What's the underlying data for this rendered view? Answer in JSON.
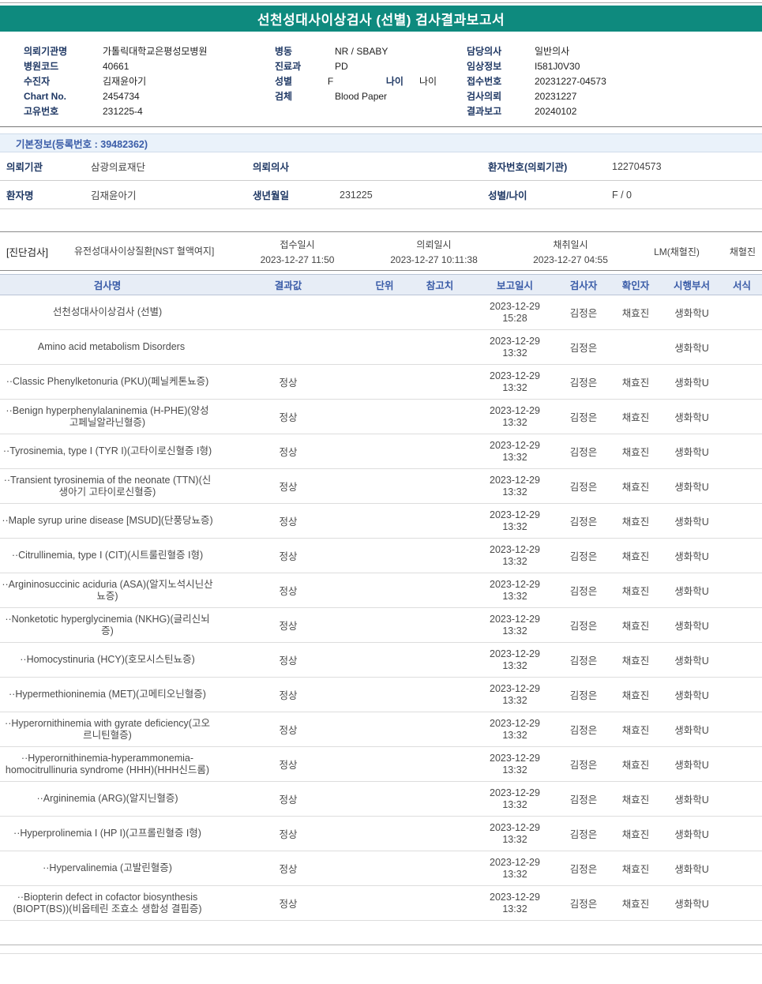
{
  "colors": {
    "accent": "#0E8A7E",
    "label": "#1F3864",
    "blue": "#3A5CA8",
    "theadbg": "#E7EDF6",
    "sectionbg": "#EAF2FA"
  },
  "report": {
    "title": "선천성대사이상검사 (선별) 검사결과보고서"
  },
  "header_info": {
    "left": [
      {
        "label": "의뢰기관명",
        "value": "가톨릭대학교은평성모병원"
      },
      {
        "label": "병원코드",
        "value": "40661"
      },
      {
        "label": "수진자",
        "value": "김재윤아기"
      },
      {
        "label": "Chart No.",
        "value": "2454734"
      },
      {
        "label": "고유번호",
        "value": "231225-4"
      }
    ],
    "middle": [
      {
        "label": "병동",
        "value": "NR / SBABY"
      },
      {
        "label": "진료과",
        "value": "PD"
      },
      {
        "label": "성별",
        "value": "F",
        "label2": "나이",
        "value2": "나이"
      },
      {
        "label": "검체",
        "value": "Blood Paper"
      }
    ],
    "right": [
      {
        "label": "담당의사",
        "value": "일반의사"
      },
      {
        "label": "임상정보",
        "value": "I581J0V30"
      },
      {
        "label": "접수번호",
        "value": "20231227-04573"
      },
      {
        "label": "검사의뢰",
        "value": "20231227"
      },
      {
        "label": "결과보고",
        "value": "20240102"
      }
    ]
  },
  "basic_info": {
    "title": "기본정보(등록번호 : 39482362)",
    "rows": [
      [
        {
          "label": "의뢰기관",
          "value": "삼광의료재단"
        },
        {
          "label": "의뢰의사",
          "value": ""
        },
        {
          "label": "환자번호(의뢰기관)",
          "value": "122704573"
        }
      ],
      [
        {
          "label": "환자명",
          "value": "김재윤아기"
        },
        {
          "label": "생년월일",
          "value": "231225"
        },
        {
          "label": "성별/나이",
          "value": "F / 0"
        }
      ]
    ]
  },
  "diagnosis": {
    "tag": "[진단검사]",
    "test_name": "유전성대사이상질환[NST 혈액여지]",
    "times": [
      {
        "label": "접수일시",
        "value": "2023-12-27 11:50"
      },
      {
        "label": "의뢰일시",
        "value": "2023-12-27 10:11:38"
      },
      {
        "label": "채취일시",
        "value": "2023-12-27 04:55"
      }
    ],
    "collector": "LM(채혈진)",
    "collector2": "채혈진"
  },
  "results": {
    "headers": [
      "검사명",
      "결과값",
      "단위",
      "참고치",
      "보고일시",
      "검사자",
      "확인자",
      "시행부서",
      "서식"
    ],
    "rows": [
      {
        "name": "선천성대사이상검사 (선별)",
        "result": "",
        "unit": "",
        "ref": "",
        "date": "2023-12-29",
        "time": "15:28",
        "tester": "김정은",
        "confirmer": "채효진",
        "dept": "생화학U",
        "format": ""
      },
      {
        "name": "Amino acid metabolism Disorders",
        "indent": 1,
        "result": "",
        "unit": "",
        "ref": "",
        "date": "2023-12-29",
        "time": "13:32",
        "tester": "김정은",
        "confirmer": "",
        "dept": "생화학U",
        "format": ""
      },
      {
        "name": "··Classic Phenylketonuria (PKU)(페닐케톤뇨증)",
        "result": "정상",
        "unit": "",
        "ref": "",
        "date": "2023-12-29",
        "time": "13:32",
        "tester": "김정은",
        "confirmer": "채효진",
        "dept": "생화학U",
        "format": ""
      },
      {
        "name": "··Benign hyperphenylalaninemia (H-PHE)(양성 고페닐알라닌혈증)",
        "result": "정상",
        "unit": "",
        "ref": "",
        "date": "2023-12-29",
        "time": "13:32",
        "tester": "김정은",
        "confirmer": "채효진",
        "dept": "생화학U",
        "format": ""
      },
      {
        "name": "··Tyrosinemia, type I (TYR I)(고타이로신혈증 I형)",
        "result": "정상",
        "unit": "",
        "ref": "",
        "date": "2023-12-29",
        "time": "13:32",
        "tester": "김정은",
        "confirmer": "채효진",
        "dept": "생화학U",
        "format": ""
      },
      {
        "name": "··Transient tyrosinemia of the neonate (TTN)(신생아기 고타이로신혈증)",
        "result": "정상",
        "unit": "",
        "ref": "",
        "date": "2023-12-29",
        "time": "13:32",
        "tester": "김정은",
        "confirmer": "채효진",
        "dept": "생화학U",
        "format": ""
      },
      {
        "name": "··Maple syrup urine disease [MSUD](단풍당뇨증)",
        "result": "정상",
        "unit": "",
        "ref": "",
        "date": "2023-12-29",
        "time": "13:32",
        "tester": "김정은",
        "confirmer": "채효진",
        "dept": "생화학U",
        "format": ""
      },
      {
        "name": "··Citrullinemia, type I (CIT)(시트룰린혈증 I형)",
        "result": "정상",
        "unit": "",
        "ref": "",
        "date": "2023-12-29",
        "time": "13:32",
        "tester": "김정은",
        "confirmer": "채효진",
        "dept": "생화학U",
        "format": ""
      },
      {
        "name": "··Argininosuccinic aciduria (ASA)(알지노석시닌산뇨증)",
        "result": "정상",
        "unit": "",
        "ref": "",
        "date": "2023-12-29",
        "time": "13:32",
        "tester": "김정은",
        "confirmer": "채효진",
        "dept": "생화학U",
        "format": ""
      },
      {
        "name": "··Nonketotic hyperglycinemia (NKHG)(글리신뇌증)",
        "result": "정상",
        "unit": "",
        "ref": "",
        "date": "2023-12-29",
        "time": "13:32",
        "tester": "김정은",
        "confirmer": "채효진",
        "dept": "생화학U",
        "format": ""
      },
      {
        "name": "··Homocystinuria (HCY)(호모시스틴뇨증)",
        "result": "정상",
        "unit": "",
        "ref": "",
        "date": "2023-12-29",
        "time": "13:32",
        "tester": "김정은",
        "confirmer": "채효진",
        "dept": "생화학U",
        "format": ""
      },
      {
        "name": "··Hypermethioninemia (MET)(고메티오닌혈증)",
        "result": "정상",
        "unit": "",
        "ref": "",
        "date": "2023-12-29",
        "time": "13:32",
        "tester": "김정은",
        "confirmer": "채효진",
        "dept": "생화학U",
        "format": ""
      },
      {
        "name": "··Hyperornithinemia with gyrate deficiency(고오르니틴혈증)",
        "result": "정상",
        "unit": "",
        "ref": "",
        "date": "2023-12-29",
        "time": "13:32",
        "tester": "김정은",
        "confirmer": "채효진",
        "dept": "생화학U",
        "format": ""
      },
      {
        "name": "··Hyperornithinemia-hyperammonemia-homocitrullinuria syndrome (HHH)(HHH신드롬)",
        "result": "정상",
        "unit": "",
        "ref": "",
        "date": "2023-12-29",
        "time": "13:32",
        "tester": "김정은",
        "confirmer": "채효진",
        "dept": "생화학U",
        "format": ""
      },
      {
        "name": "··Argininemia (ARG)(알지닌혈증)",
        "result": "정상",
        "unit": "",
        "ref": "",
        "date": "2023-12-29",
        "time": "13:32",
        "tester": "김정은",
        "confirmer": "채효진",
        "dept": "생화학U",
        "format": ""
      },
      {
        "name": "··Hyperprolinemia I (HP I)(고프롤린혈증 I형)",
        "result": "정상",
        "unit": "",
        "ref": "",
        "date": "2023-12-29",
        "time": "13:32",
        "tester": "김정은",
        "confirmer": "채효진",
        "dept": "생화학U",
        "format": ""
      },
      {
        "name": "··Hypervalinemia (고발린혈증)",
        "result": "정상",
        "unit": "",
        "ref": "",
        "date": "2023-12-29",
        "time": "13:32",
        "tester": "김정은",
        "confirmer": "채효진",
        "dept": "생화학U",
        "format": ""
      },
      {
        "name": "··Biopterin defect in cofactor biosynthesis (BIOPT(BS))(비옵테린 조효소 생합성 결핍증)",
        "result": "정상",
        "unit": "",
        "ref": "",
        "date": "2023-12-29",
        "time": "13:32",
        "tester": "김정은",
        "confirmer": "채효진",
        "dept": "생화학U",
        "format": ""
      }
    ]
  }
}
